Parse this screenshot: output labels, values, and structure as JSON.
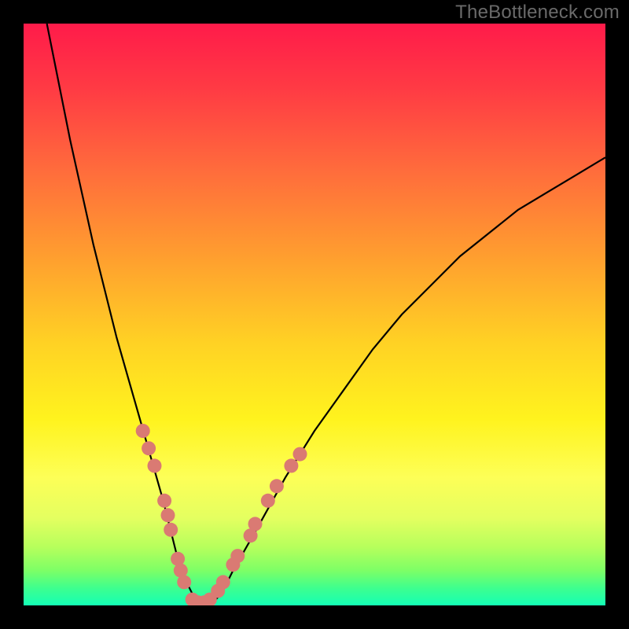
{
  "watermark": "TheBottleneck.com",
  "colors": {
    "frame": "#000000",
    "curve_stroke": "#000000",
    "marker_fill": "#da7a73",
    "marker_stroke": "#b85a52"
  },
  "chart_data": {
    "type": "line",
    "title": "",
    "xlabel": "",
    "ylabel": "",
    "xlim": [
      0,
      100
    ],
    "ylim": [
      0,
      100
    ],
    "series": [
      {
        "name": "bottleneck-curve",
        "x": [
          4,
          6,
          8,
          10,
          12,
          14,
          16,
          18,
          20,
          22,
          24,
          25,
          26,
          27,
          30,
          32,
          34,
          36,
          40,
          45,
          50,
          55,
          60,
          65,
          70,
          75,
          80,
          85,
          90,
          95,
          100
        ],
        "y": [
          100,
          90,
          80,
          71,
          62,
          54,
          46,
          39,
          32,
          25,
          18,
          14,
          10,
          6,
          0,
          0,
          2,
          6,
          13,
          22,
          30,
          37,
          44,
          50,
          55,
          60,
          64,
          68,
          71,
          74,
          77
        ]
      }
    ],
    "markers": [
      {
        "x": 20.5,
        "y": 30
      },
      {
        "x": 21.5,
        "y": 27
      },
      {
        "x": 22.5,
        "y": 24
      },
      {
        "x": 24.2,
        "y": 18
      },
      {
        "x": 24.8,
        "y": 15.5
      },
      {
        "x": 25.3,
        "y": 13
      },
      {
        "x": 26.5,
        "y": 8
      },
      {
        "x": 27.0,
        "y": 6
      },
      {
        "x": 27.6,
        "y": 4
      },
      {
        "x": 29.0,
        "y": 1
      },
      {
        "x": 30.0,
        "y": 0.5
      },
      {
        "x": 31.0,
        "y": 0.5
      },
      {
        "x": 32.0,
        "y": 1
      },
      {
        "x": 33.4,
        "y": 2.5
      },
      {
        "x": 34.3,
        "y": 4
      },
      {
        "x": 36.0,
        "y": 7
      },
      {
        "x": 36.8,
        "y": 8.5
      },
      {
        "x": 39.0,
        "y": 12
      },
      {
        "x": 39.8,
        "y": 14
      },
      {
        "x": 42.0,
        "y": 18
      },
      {
        "x": 43.5,
        "y": 20.5
      },
      {
        "x": 46.0,
        "y": 24
      },
      {
        "x": 47.5,
        "y": 26
      }
    ]
  }
}
